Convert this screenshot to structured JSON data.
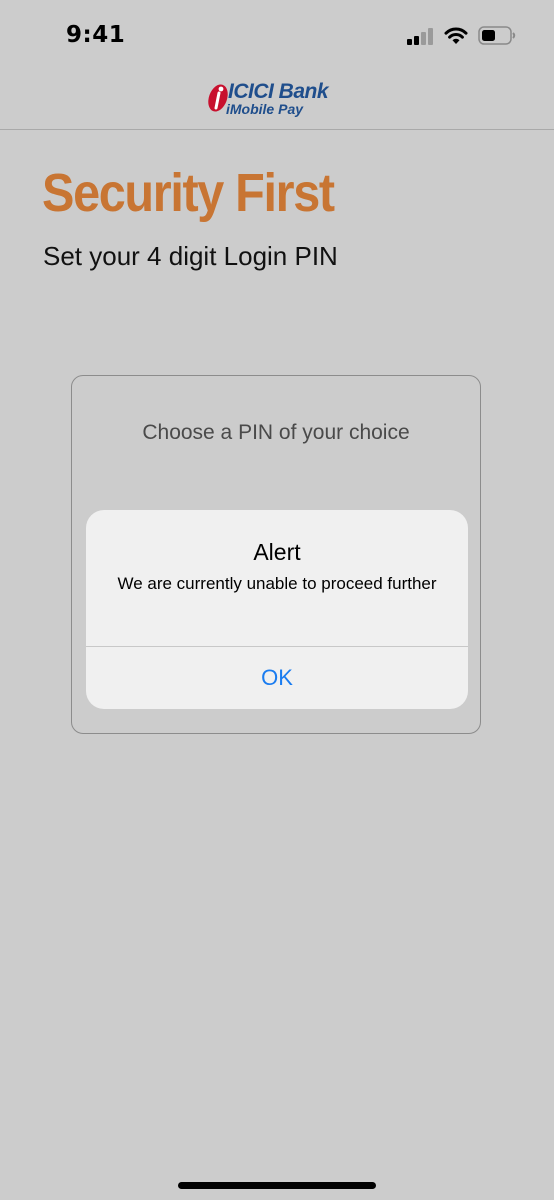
{
  "status_bar": {
    "time": "9:41",
    "icons": [
      "cellular-signal-icon",
      "wifi-icon",
      "battery-icon"
    ]
  },
  "header": {
    "logo_name": "ICICI Bank",
    "logo_sub": "iMobile Pay",
    "brand_colors": {
      "red": "#c8102e",
      "blue": "#1f4e8c"
    }
  },
  "main": {
    "title": "Security First",
    "subtitle": "Set your 4 digit Login PIN",
    "pin_prompt": "Choose a PIN of your choice",
    "title_color": "#c87533"
  },
  "alert": {
    "title": "Alert",
    "message": "We are currently unable to proceed further",
    "ok_label": "OK",
    "button_color": "#1a7cf0"
  }
}
